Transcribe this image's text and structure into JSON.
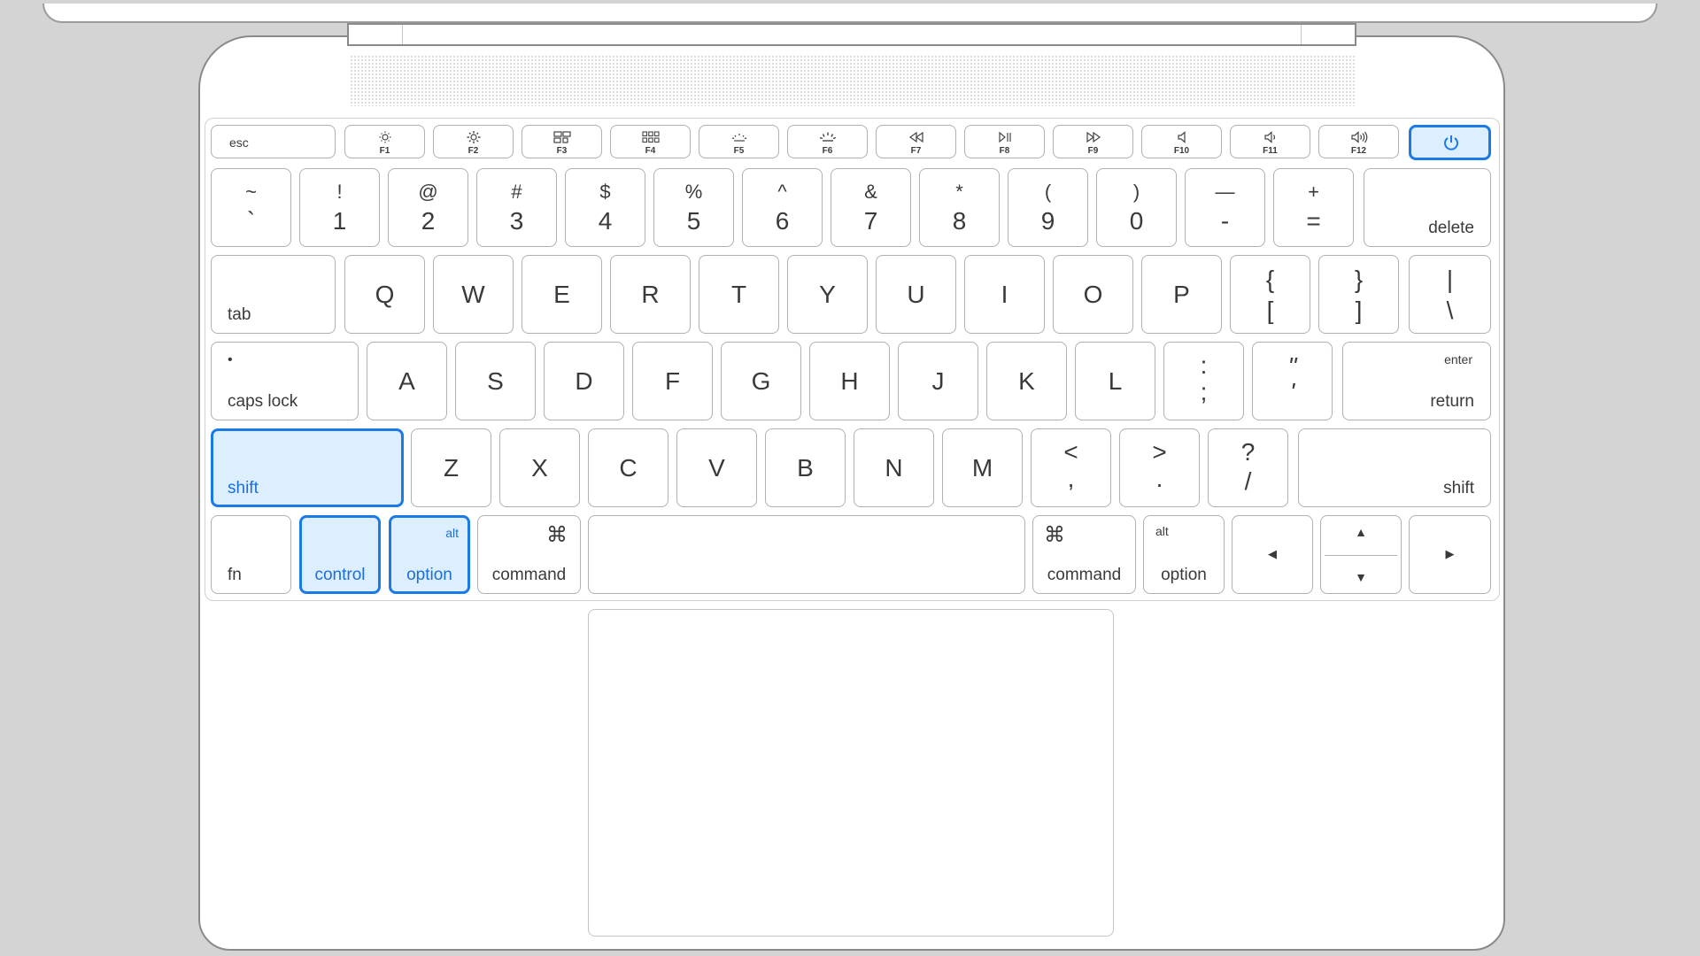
{
  "colors": {
    "highlight_border": "#1a7ae8",
    "highlight_fill": "#ddeeff",
    "key_border": "#b0b0b0",
    "background": "#d4d4d4"
  },
  "highlighted_keys": [
    "left-shift",
    "left-control",
    "left-option",
    "power"
  ],
  "keys": {
    "esc": "esc",
    "f1": "F1",
    "f2": "F2",
    "f3": "F3",
    "f4": "F4",
    "f5": "F5",
    "f6": "F6",
    "f7": "F7",
    "f8": "F8",
    "f9": "F9",
    "f10": "F10",
    "f11": "F11",
    "f12": "F12",
    "backtick_top": "~",
    "backtick_bottom": "`",
    "n1_top": "!",
    "n1": "1",
    "n2_top": "@",
    "n2": "2",
    "n3_top": "#",
    "n3": "3",
    "n4_top": "$",
    "n4": "4",
    "n5_top": "%",
    "n5": "5",
    "n6_top": "^",
    "n6": "6",
    "n7_top": "&",
    "n7": "7",
    "n8_top": "*",
    "n8": "8",
    "n9_top": "(",
    "n9": "9",
    "n0_top": ")",
    "n0": "0",
    "minus_top": "—",
    "minus": "-",
    "equal_top": "+",
    "equal": "=",
    "delete": "delete",
    "tab": "tab",
    "q": "Q",
    "w": "W",
    "e": "E",
    "r": "R",
    "t": "T",
    "y": "Y",
    "u": "U",
    "i": "I",
    "o": "O",
    "p": "P",
    "lbracket_top": "{",
    "lbracket": "[",
    "rbracket_top": "}",
    "rbracket": "]",
    "backslash_top": "|",
    "backslash": "\\",
    "capslock": "caps lock",
    "capslock_dot": "•",
    "a": "A",
    "s": "S",
    "d": "D",
    "f": "F",
    "g": "G",
    "h": "H",
    "j": "J",
    "k": "K",
    "l": "L",
    "semicolon_top": ":",
    "semicolon": ";",
    "quote_top": "\"",
    "quote": "'",
    "return_top": "enter",
    "return": "return",
    "shift": "shift",
    "z": "Z",
    "x": "X",
    "c": "C",
    "v": "V",
    "b": "B",
    "n": "N",
    "m": "M",
    "comma_top": "<",
    "comma": ",",
    "period_top": ">",
    "period": ".",
    "slash_top": "?",
    "slash": "/",
    "fn": "fn",
    "control": "control",
    "alt": "alt",
    "option": "option",
    "command": "command",
    "command_symbol": "⌘",
    "arrow_left": "◀",
    "arrow_up": "▲",
    "arrow_down": "▼",
    "arrow_right": "▶"
  }
}
